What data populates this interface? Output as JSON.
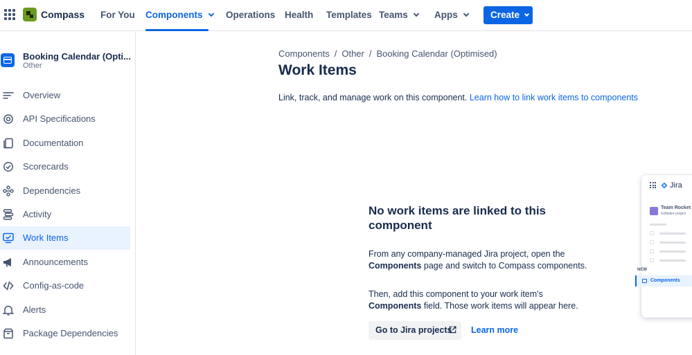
{
  "topnav": {
    "logo_text": "Compass",
    "items": [
      "For You",
      "Components",
      "Operations",
      "Health",
      "Templates",
      "Teams",
      "Apps"
    ],
    "create_label": "Create"
  },
  "sidebar": {
    "component_name": "Booking Calendar (Opti...",
    "component_type": "Other",
    "items": [
      {
        "label": "Overview",
        "icon": "overview-icon"
      },
      {
        "label": "API Specifications",
        "icon": "api-icon"
      },
      {
        "label": "Documentation",
        "icon": "documentation-icon"
      },
      {
        "label": "Scorecards",
        "icon": "scorecard-icon"
      },
      {
        "label": "Dependencies",
        "icon": "dependencies-icon"
      },
      {
        "label": "Activity",
        "icon": "activity-icon"
      },
      {
        "label": "Work Items",
        "icon": "work-items-icon",
        "active": true
      },
      {
        "label": "Announcements",
        "icon": "megaphone-icon"
      },
      {
        "label": "Config-as-code",
        "icon": "code-icon"
      },
      {
        "label": "Alerts",
        "icon": "bell-icon"
      },
      {
        "label": "Package Dependencies",
        "icon": "package-icon"
      }
    ]
  },
  "main": {
    "breadcrumb": [
      "Components",
      "Other",
      "Booking Calendar (Optimised)"
    ],
    "title": "Work Items",
    "description": "Link, track, and manage work on this component.",
    "description_link": "Learn how to link work items to components",
    "empty_title": "No work items are linked to this component",
    "para1_a": "From any company-managed Jira project, open the ",
    "para1_b": "Components",
    "para1_c": " page and switch to Compass components.",
    "para2_a": "Then, add this component to your work item's ",
    "para2_b": "Components",
    "para2_c": " field. Those work items will appear here.",
    "jira_button": "Go to Jira projects",
    "learn_more": "Learn more"
  },
  "preview": {
    "app_name": "Jira",
    "team_name": "Team Rocket",
    "team_sub": "Software project",
    "new_badge": "NEW",
    "components_label": "Components"
  },
  "colors": {
    "accent": "#0c66e4",
    "active_bg": "#e9f2ff",
    "logo_green": "#6a9a23"
  }
}
